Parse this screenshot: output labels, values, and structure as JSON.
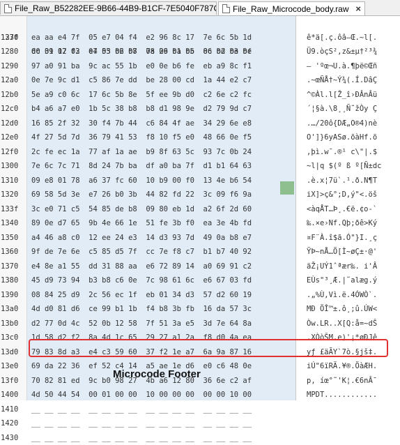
{
  "tabs": [
    {
      "label": "File_Raw_B52282EE-9B66-44B9-B1CF-7E5040F787C1.ffs",
      "icon": "file-icon",
      "active": false
    },
    {
      "label": "File_Raw_Microcode_body.raw",
      "icon": "file-icon",
      "active": true,
      "close": "×"
    }
  ],
  "header": {
    "offset": "133f",
    "columns": "00 01 02 03  04 05 06 07  08 09 0a 0b  0c 0d 0e 0f"
  },
  "rows": [
    {
      "offset": "1270",
      "hex": "ea aa e4 7f  05 e7 04 f4  e2 96 8c 17  7e 6c 5b 1d",
      "ascii": "ê*ä[.ç.ôâ–Œ.~l[."
    },
    {
      "offset": "1280",
      "hex": "dc 39 17 f2  e7 53 b2 b8  7a 26 b1 b5  86 b2 b3 be",
      "ascii": "Ü9.òçS²,z&±µ†²³¾"
    },
    {
      "offset": "1290",
      "hex": "97 a0 91 ba  9c ac 55 1b  e0 0e b6 fe  eb a9 8c f1",
      "ascii": "— 'ºœ¬U.à.¶þë©Œñ"
    },
    {
      "offset": "12a0",
      "hex": "0e 7e 9c d1  c5 86 7e dd  be 28 00 cd  1a 44 e2 c7",
      "ascii": ".~œÑÅ†~Ý¾(.Í.DâÇ"
    },
    {
      "offset": "12b0",
      "hex": "5e a9 c0 6c  17 6c 5b 8e  5f ee 9b d0  c2 6e c2 fc",
      "ascii": "^©Àl.l[Ž_î›ÐÂnÂü"
    },
    {
      "offset": "12c0",
      "hex": "b4 a6 a7 e0  1b 5c 38 b8  b8 d1 98 9e  d2 79 9d c7",
      "ascii": "´¦§à.\\8¸¸Ñ˜žÒy Ç"
    },
    {
      "offset": "12d0",
      "hex": "16 85 2f 32  30 f4 7b 44  c6 84 4f ae  34 29 6e e8",
      "ascii": ".…/20ô{DÆ„O®4)nè"
    },
    {
      "offset": "12e0",
      "hex": "4f 27 5d 7d  36 79 41 53  f8 10 f5 e0  48 66 0e f5",
      "ascii": "O']}6yASø.õàHf.õ"
    },
    {
      "offset": "12f0",
      "hex": "2c fe ec 1a  77 af 1a ae  b9 8f 63 5c  93 7c 0b 24",
      "ascii": ",þì.w¯.®¹ c\\\"|.$"
    },
    {
      "offset": "1300",
      "hex": "7e 6c 7c 71  8d 24 7b ba  df a0 ba 7f  d1 b1 64 63",
      "ascii": "~l|q $(º ß º[Ñ±dc"
    },
    {
      "offset": "1310",
      "hex": "09 e8 01 78  a6 37 fc 60  10 b9 00 f0  13 4e b6 54",
      "ascii": ".è.x¦7ü`.¹.ð.N¶T"
    },
    {
      "offset": "1320",
      "hex": "69 58 5d 3e  e7 26 b0 3b  44 82 fd 22  3c 09 f6 9a",
      "ascii": "iX]>ç&°;D‚ý\"<.öš"
    },
    {
      "offset": "133f",
      "hex": "3c e0 71 c5  54 85 de b8  09 80 eb 1d  a2 6f 2d 60",
      "ascii": "<àqÅT…Þ¸.€ë.¢o-`"
    },
    {
      "offset": "1340",
      "hex": "89 0e d7 65  9b 4e 66 1e  51 fe 3b f0  ea 3e 4b fd",
      "ascii": "‰.×e›Nf.Qþ;ðê>Ký"
    },
    {
      "offset": "1350",
      "hex": "a4 46 a8 c0  12 ee 24 e3  14 d3 93 7d  49 0a b8 e7",
      "ascii": "¤F¨À.î$ã.Ó\"}I.¸ç"
    },
    {
      "offset": "1360",
      "hex": "9f de 7e 6e  c5 85 d5 7f  cc 7e f8 c7  b1 b7 40 92",
      "ascii": "ŸÞ~nÅ…Õ[Ì~øÇ±·@'"
    },
    {
      "offset": "1370",
      "hex": "e4 8e a1 55  dd 31 88 aa  e6 72 89 14  a0 69 91 c2",
      "ascii": "äŽ¡UÝ1ˆªær‰. i'Â"
    },
    {
      "offset": "1380",
      "hex": "45 d9 73 94  b3 b8 c6 0e  7c 98 61 6c  e6 67 03 fd",
      "ascii": "EÙs\"³¸Æ.|˜alæg.ý"
    },
    {
      "offset": "1390",
      "hex": "08 84 25 d9  2c 56 ec 1f  eb 01 34 d3  57 d2 60 19",
      "ascii": ".„%Ù,Vì.ë.4ÓWÒ`."
    },
    {
      "offset": "13a0",
      "hex": "4d d0 81 d6  ce 99 b1 1b  f4 b8 3b fb  16 da 57 3c",
      "ascii": "MÐ ÖÎ™±.ô¸;û.ÚW<"
    },
    {
      "offset": "13b0",
      "hex": "d2 77 0d 4c  52 0b 12 58  7f 51 3a e5  3d 7e 64 8a",
      "ascii": "Òw.LR..X[Q:å=~dŠ"
    },
    {
      "offset": "13c0",
      "hex": "1d 58 d2 f2  8a 4d 1c 65  29 27 a1 2a  f8 d0 4a ea",
      "ascii": ".XÒòŠM.e)'¡*øÐJê"
    },
    {
      "offset": "13d0",
      "hex": "79 83 8d a3  e4 c3 59 60  37 f2 1e a7  6a 9a 87 16",
      "ascii": "yƒ £äÃY`7ò.§jš‡."
    },
    {
      "offset": "13e0",
      "hex": "69 da 22 36  ef 52 c4 14  a5 ae 1e d6  e0 c6 48 0e",
      "ascii": "iÚ\"6ïRÄ.¥®.ÖàÆH."
    },
    {
      "offset": "13f0",
      "hex": "70 82 81 ed  9c b0 98 27  4b a6 12 80  36 6e c2 af",
      "ascii": "p‚ íœ°˜'K¦.€6nÂ¯"
    },
    {
      "offset": "1400",
      "hex": "4d 50 44 54  00 01 00 00  10 00 00 00  00 00 10 00",
      "ascii": "MPDT............"
    },
    {
      "offset": "1410",
      "hex": "__ __ __ __  __ __ __ __  __ __ __ __  __ __ __ __",
      "ascii": ""
    },
    {
      "offset": "1420",
      "hex": "__ __ __ __  __ __ __ __  __ __ __ __  __ __ __ __",
      "ascii": ""
    },
    {
      "offset": "1430",
      "hex": "__ __ __ __  __ __ __ __  __ __ __ __  __ __ __ __",
      "ascii": ""
    }
  ],
  "selected_byte": "60",
  "annotation": {
    "label": "Microcode Footer",
    "color": "#e03030"
  }
}
